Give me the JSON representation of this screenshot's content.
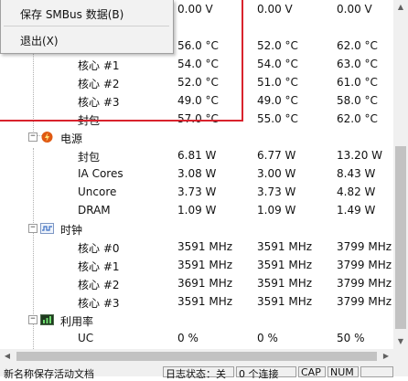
{
  "menu": {
    "items": [
      {
        "label": "保存 SMBus 数据(B)"
      },
      {
        "label": "退出(X)"
      }
    ]
  },
  "tree": {
    "top_values": [
      "0.00 V",
      "0.00 V",
      "0.00 V"
    ],
    "temperature_rows": [
      {
        "label": "",
        "v1": "56.0 °C",
        "v2": "52.0 °C",
        "v3": "62.0 °C"
      },
      {
        "label": "核心 #1",
        "v1": "54.0 °C",
        "v2": "54.0 °C",
        "v3": "63.0 °C"
      },
      {
        "label": "核心 #2",
        "v1": "52.0 °C",
        "v2": "51.0 °C",
        "v3": "61.0 °C"
      },
      {
        "label": "核心 #3",
        "v1": "49.0 °C",
        "v2": "49.0 °C",
        "v3": "58.0 °C"
      },
      {
        "label": "封包",
        "v1": "57.0 °C",
        "v2": "55.0 °C",
        "v3": "62.0 °C"
      }
    ],
    "power": {
      "label": "电源",
      "rows": [
        {
          "label": "封包",
          "v1": "6.81 W",
          "v2": "6.77 W",
          "v3": "13.20 W"
        },
        {
          "label": "IA Cores",
          "v1": "3.08 W",
          "v2": "3.00 W",
          "v3": "8.43 W"
        },
        {
          "label": "Uncore",
          "v1": "3.73 W",
          "v2": "3.73 W",
          "v3": "4.82 W"
        },
        {
          "label": "DRAM",
          "v1": "1.09 W",
          "v2": "1.09 W",
          "v3": "1.49 W"
        }
      ]
    },
    "clocks": {
      "label": "时钟",
      "rows": [
        {
          "label": "核心 #0",
          "v1": "3591 MHz",
          "v2": "3591 MHz",
          "v3": "3799 MHz"
        },
        {
          "label": "核心 #1",
          "v1": "3591 MHz",
          "v2": "3591 MHz",
          "v3": "3799 MHz"
        },
        {
          "label": "核心 #2",
          "v1": "3691 MHz",
          "v2": "3591 MHz",
          "v3": "3799 MHz"
        },
        {
          "label": "核心 #3",
          "v1": "3591 MHz",
          "v2": "3591 MHz",
          "v3": "3799 MHz"
        }
      ]
    },
    "utilization": {
      "label": "利用率",
      "rows": [
        {
          "label": "UC",
          "v1": "0 %",
          "v2": "0 %",
          "v3": "50 %"
        }
      ]
    }
  },
  "statusbar": {
    "message": "新名称保存活动文档",
    "log_state": "日志状态：关",
    "connections": "0 个连接",
    "cap": "CAP",
    "num": "NUM"
  },
  "colors": {
    "highlight_box": "#d9232d",
    "menu_bg": "#f2f2f2",
    "power_icon": "#e05a12",
    "clock_icon": "#3a6fc4",
    "util_icon": "#2e7d32"
  }
}
